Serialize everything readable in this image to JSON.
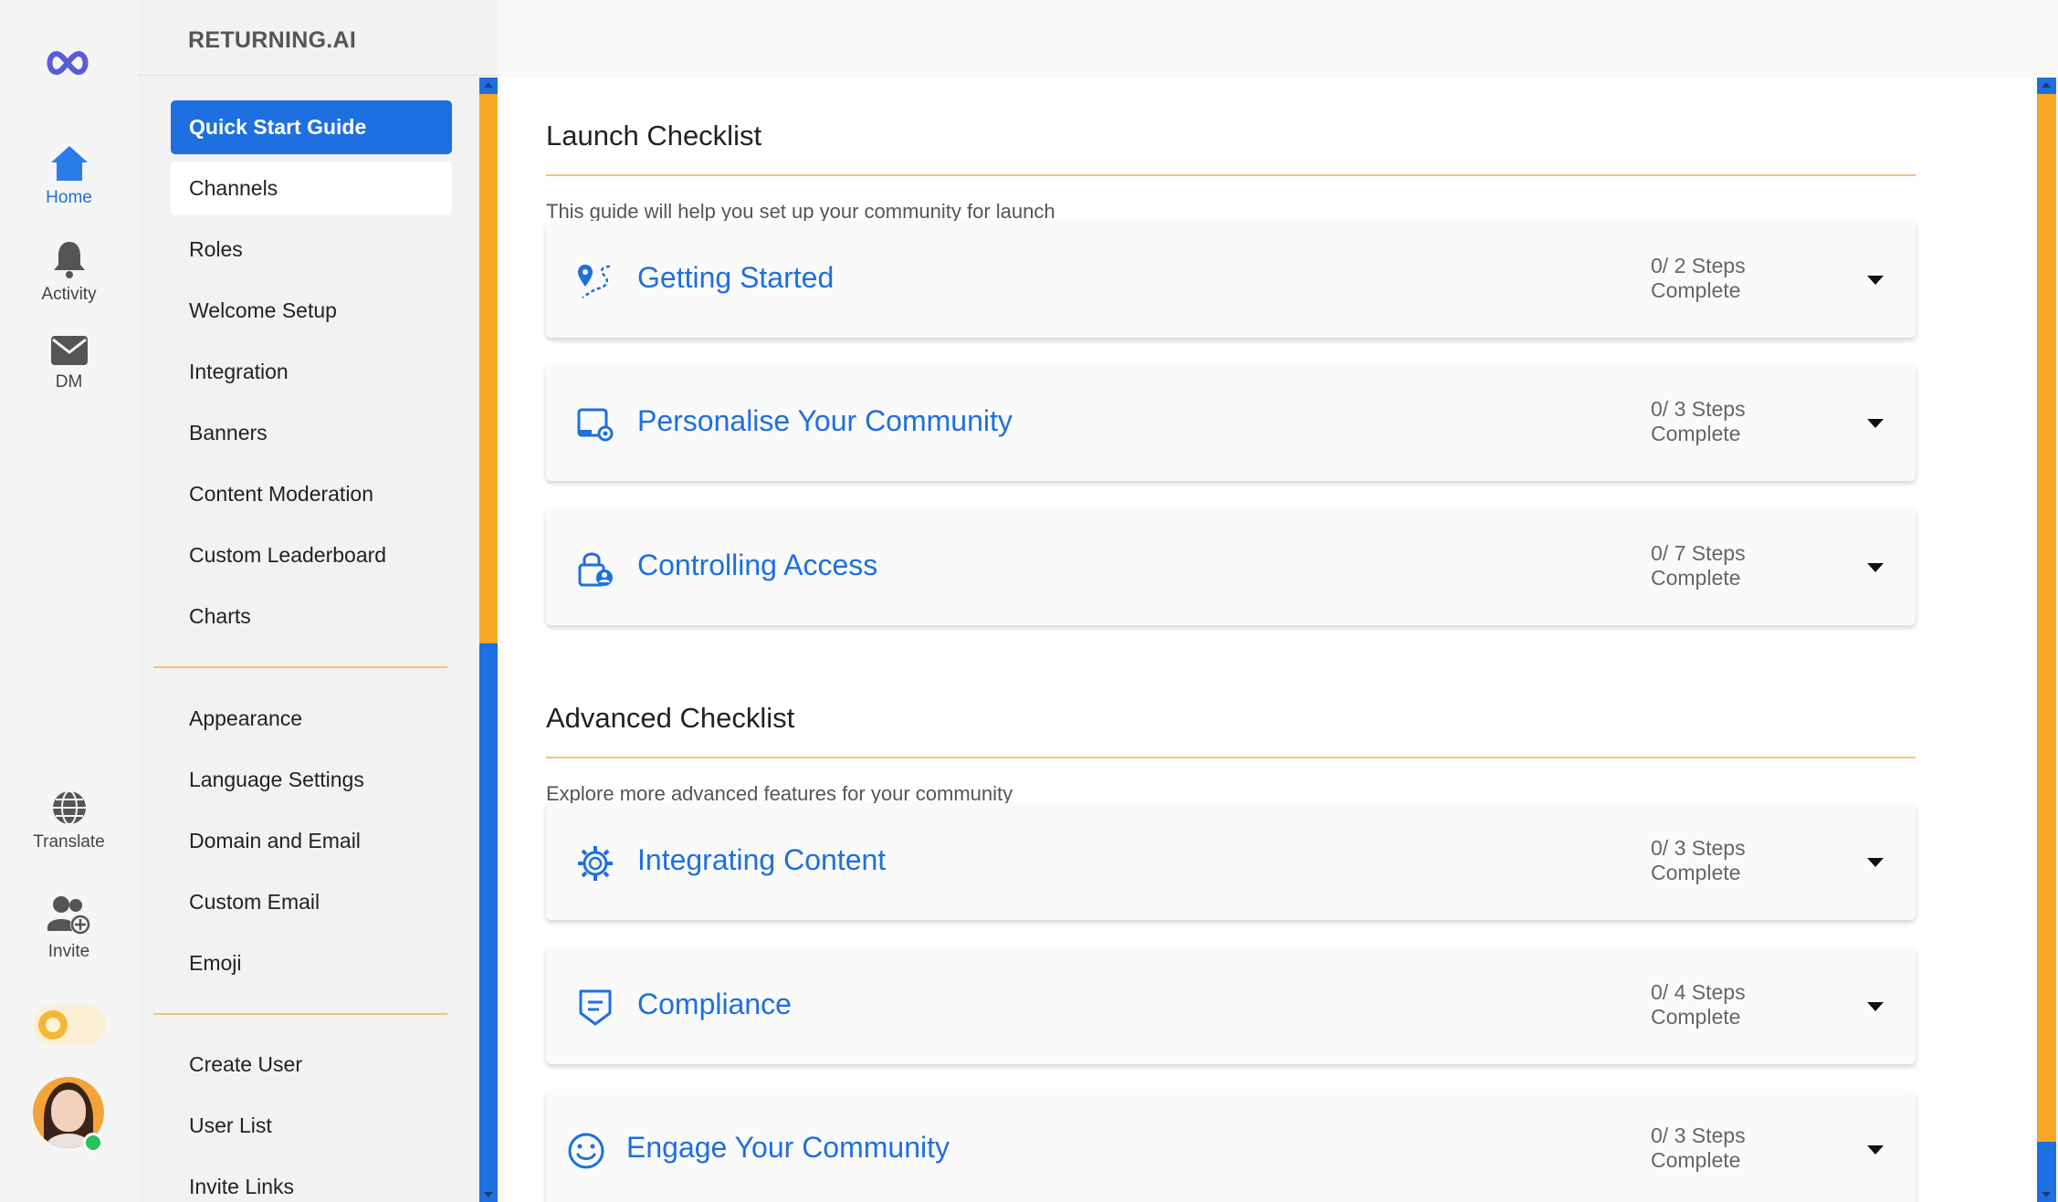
{
  "rail": {
    "home_label": "Home",
    "activity_label": "Activity",
    "dm_label": "DM",
    "translate_label": "Translate",
    "invite_label": "Invite"
  },
  "sidebar": {
    "brand": "RETURNING.AI",
    "group1": [
      "Quick Start Guide",
      "Channels",
      "Roles",
      "Welcome Setup",
      "Integration",
      "Banners",
      "Content Moderation",
      "Custom Leaderboard",
      "Charts"
    ],
    "group2": [
      "Appearance",
      "Language Settings",
      "Domain and Email",
      "Custom Email",
      "Emoji"
    ],
    "group3": [
      "Create User",
      "User List",
      "Invite Links"
    ]
  },
  "launch": {
    "title": "Launch Checklist",
    "subtitle": "This guide will help you set up your community for launch",
    "cards": [
      {
        "title": "Getting Started",
        "steps": "0/ 2 Steps",
        "complete": "Complete",
        "icon": "map-route-icon"
      },
      {
        "title": "Personalise Your Community",
        "steps": "0/ 3 Steps",
        "complete": "Complete",
        "icon": "screen-settings-icon"
      },
      {
        "title": "Controlling Access",
        "steps": "0/ 7 Steps",
        "complete": "Complete",
        "icon": "lock-user-icon"
      }
    ]
  },
  "advanced": {
    "title": "Advanced Checklist",
    "subtitle": "Explore more advanced features for your community",
    "cards": [
      {
        "title": "Integrating Content",
        "steps": "0/ 3 Steps",
        "complete": "Complete",
        "icon": "gear-sync-icon"
      },
      {
        "title": "Compliance",
        "steps": "0/ 4 Steps",
        "complete": "Complete",
        "icon": "shield-doc-icon"
      },
      {
        "title": "Engage Your Community",
        "steps": "0/ 3 Steps",
        "complete": "Complete",
        "icon": "smiley-icon"
      }
    ]
  },
  "colors": {
    "accent": "#1e6fe0",
    "scroll_thumb": "#f5a623",
    "divider": "#f4c27a"
  }
}
